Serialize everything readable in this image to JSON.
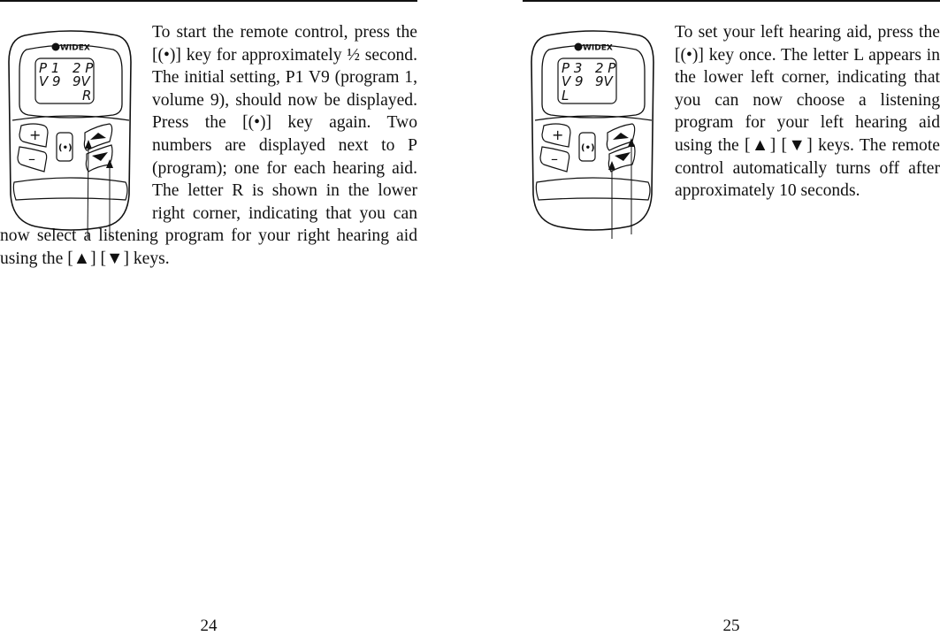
{
  "pages": [
    {
      "side": "left",
      "page_number": "24",
      "device": {
        "brand": "WIDEX",
        "display": {
          "row1_left": "P 1",
          "row1_right": "2 P",
          "row2_left": "V 9",
          "row2_right": "9V",
          "corner_letter": "R",
          "corner_position": "lower-right"
        },
        "keys": {
          "plus": "+",
          "minus": "–",
          "center": "(•)",
          "up": "▲",
          "down": "▼"
        }
      },
      "paragraph_first": "To start the remote control, press the [(•)] key for approximately ½ second. The initial setting, P1 V9 (program 1, volume 9), should now be displayed. Press the [(•)] key again. Two numbers are displayed next to P (program); one for each hearing aid. The letter R is shown in the lower right corner, indicating that you can now select a listening program for your right hearing aid using the [▲] [▼] keys."
    },
    {
      "side": "right",
      "page_number": "25",
      "device": {
        "brand": "WIDEX",
        "display": {
          "row1_left": "P 3",
          "row1_right": "2 P",
          "row2_left": "V 9",
          "row2_right": "9V",
          "corner_letter": "L",
          "corner_position": "lower-left"
        },
        "keys": {
          "plus": "+",
          "minus": "–",
          "center": "(•)",
          "up": "▲",
          "down": "▼"
        }
      },
      "paragraph_first": "To set your left hearing aid, press the [(•)] key once. The letter L appears in the lower left corner, indicating that you can now choose a listening program for your left hearing aid using the [▲] [▼] keys. The remote control automatically turns off after approximately 10 seconds."
    }
  ]
}
